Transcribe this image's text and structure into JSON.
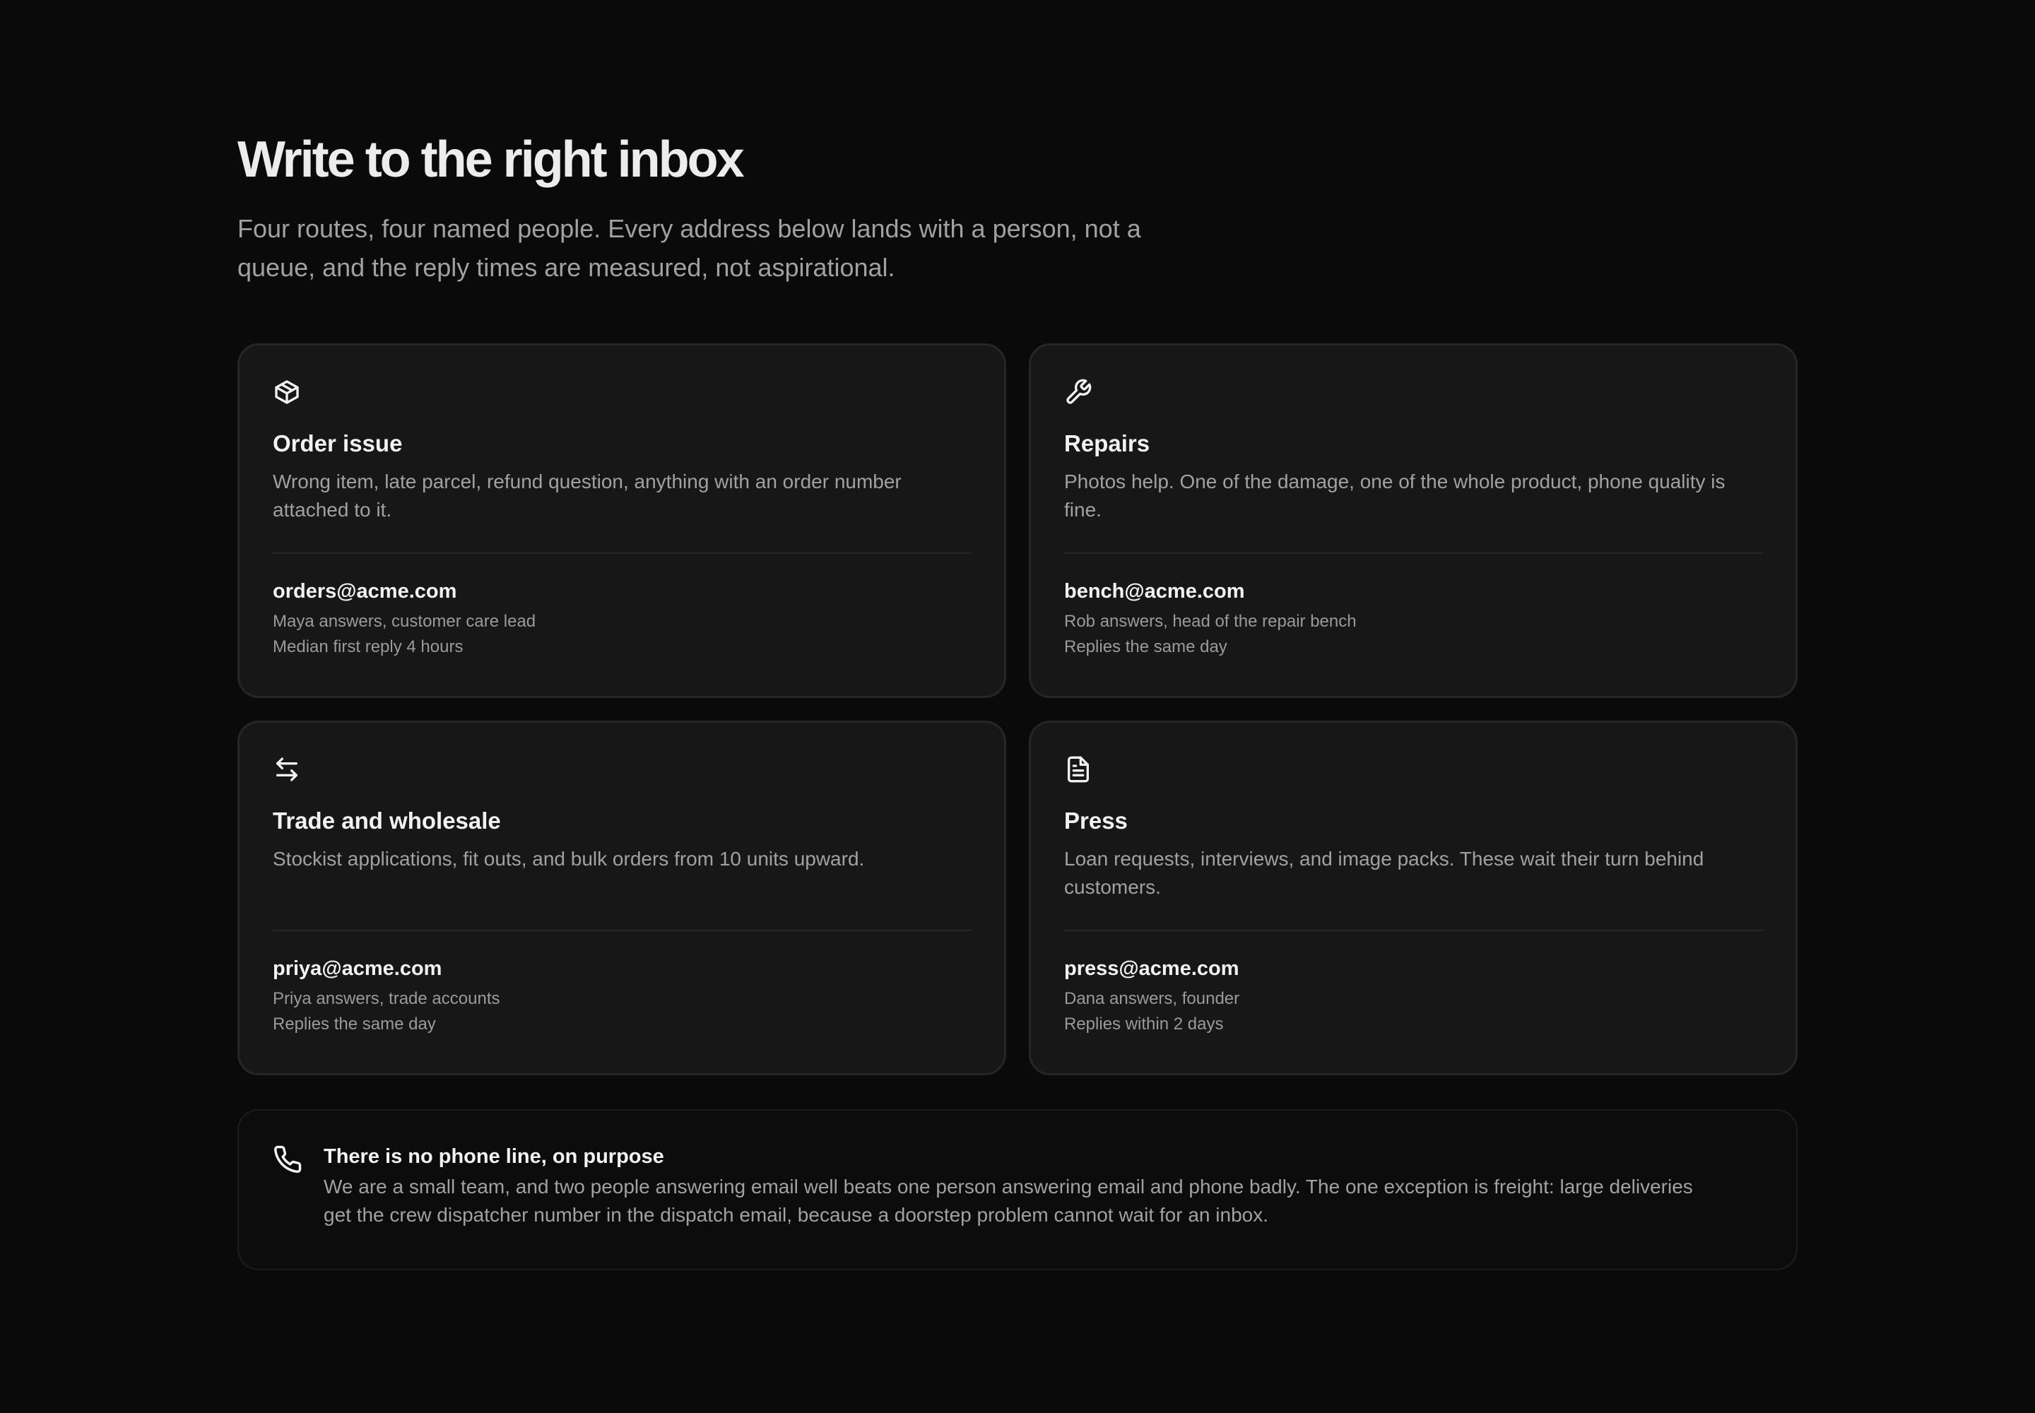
{
  "header": {
    "title": "Write to the right inbox",
    "subtitle": "Four routes, four named people. Every address below lands with a person, not a queue, and the reply times are measured, not aspirational."
  },
  "cards": [
    {
      "icon": "package-icon",
      "title": "Order issue",
      "description": "Wrong item, late parcel, refund question, anything with an order number attached to it.",
      "email": "orders@acme.com",
      "contact": "Maya answers, customer care lead",
      "reply_time": "Median first reply 4 hours"
    },
    {
      "icon": "wrench-icon",
      "title": "Repairs",
      "description": "Photos help. One of the damage, one of the whole product, phone quality is fine.",
      "email": "bench@acme.com",
      "contact": "Rob answers, head of the repair bench",
      "reply_time": "Replies the same day"
    },
    {
      "icon": "arrows-exchange-icon",
      "title": "Trade and wholesale",
      "description": "Stockist applications, fit outs, and bulk orders from 10 units upward.",
      "email": "priya@acme.com",
      "contact": "Priya answers, trade accounts",
      "reply_time": "Replies the same day"
    },
    {
      "icon": "document-icon",
      "title": "Press",
      "description": "Loan requests, interviews, and image packs. These wait their turn behind customers.",
      "email": "press@acme.com",
      "contact": "Dana answers, founder",
      "reply_time": "Replies within 2 days"
    }
  ],
  "notice": {
    "icon": "phone-icon",
    "title": "There is no phone line, on purpose",
    "text": "We are a small team, and two people answering email well beats one person answering email and phone badly. The one exception is freight: large deliveries get the crew dispatcher number in the dispatch email, because a doorstep problem cannot wait for an inbox."
  },
  "colors": {
    "background": "#0a0a0a",
    "card": "#171717",
    "border": "#262626",
    "text": "#ededed",
    "muted": "#a1a1a1"
  }
}
